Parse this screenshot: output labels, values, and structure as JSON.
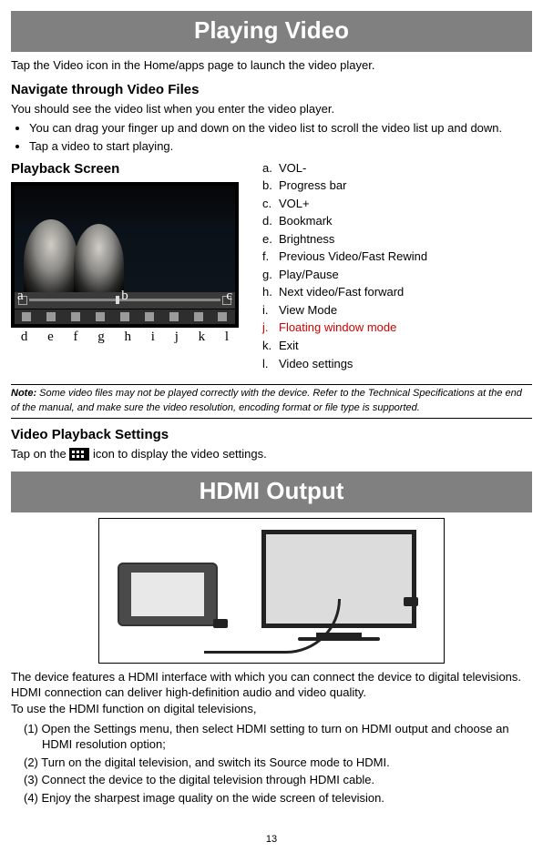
{
  "banner1": "Playing Video",
  "intro1": "Tap the Video icon in the Home/apps page to launch the video player.",
  "nav_h": "Navigate through Video Files",
  "nav_p": "You should see the video list when you enter the video player.",
  "bullets": {
    "b1": "You can drag your finger up and down on the video list to scroll the video list up and down.",
    "b2": "Tap a video to start playing."
  },
  "playback_h": "Playback Screen",
  "overlay": {
    "a": "a",
    "b": "b",
    "c": "c"
  },
  "under": {
    "d": "d",
    "e": "e",
    "f": "f",
    "g": "g",
    "h": "h",
    "i": "i",
    "j": "j",
    "k": "k",
    "l": "l"
  },
  "legend": {
    "a": {
      "k": "a.",
      "v": "VOL-"
    },
    "b": {
      "k": "b.",
      "v": "Progress bar"
    },
    "c": {
      "k": "c.",
      "v": "VOL+"
    },
    "d": {
      "k": "d.",
      "v": "Bookmark"
    },
    "e": {
      "k": "e.",
      "v": "Brightness"
    },
    "f": {
      "k": "f.",
      "v": "Previous Video/Fast Rewind"
    },
    "g": {
      "k": "g.",
      "v": "Play/Pause"
    },
    "h": {
      "k": "h.",
      "v": "Next video/Fast forward"
    },
    "i": {
      "k": "i.",
      "v": "View Mode"
    },
    "j": {
      "k": "j.",
      "v": "Floating window mode"
    },
    "k": {
      "k": "k.",
      "v": "Exit"
    },
    "l": {
      "k": "l.",
      "v": "Video settings"
    }
  },
  "note_label": "Note:",
  "note_text": " Some video files may not be played correctly with the device. Refer to the Technical Specifications at the end of the manual, and make sure the video resolution, encoding format or file type is supported.",
  "vps_h": "Video Playback Settings",
  "vps_p1": "Tap on the ",
  "vps_p2": " icon to display the video settings.",
  "banner2": "HDMI Output",
  "hdmi_p1": "The device features a HDMI interface with which you can connect the device to digital televisions. HDMI connection can deliver high-definition audio and video quality.",
  "hdmi_p2": "To use the HDMI function on digital televisions,",
  "steps": {
    "s1": "(1) Open the Settings menu, then select HDMI setting to turn on HDMI output and choose an HDMI resolution option;",
    "s2": "(2) Turn on the digital television, and switch its Source mode to HDMI.",
    "s3": "(3) Connect the device to the digital television through HDMI cable.",
    "s4": "(4) Enjoy the sharpest image quality on the wide screen of television."
  },
  "page": "13"
}
